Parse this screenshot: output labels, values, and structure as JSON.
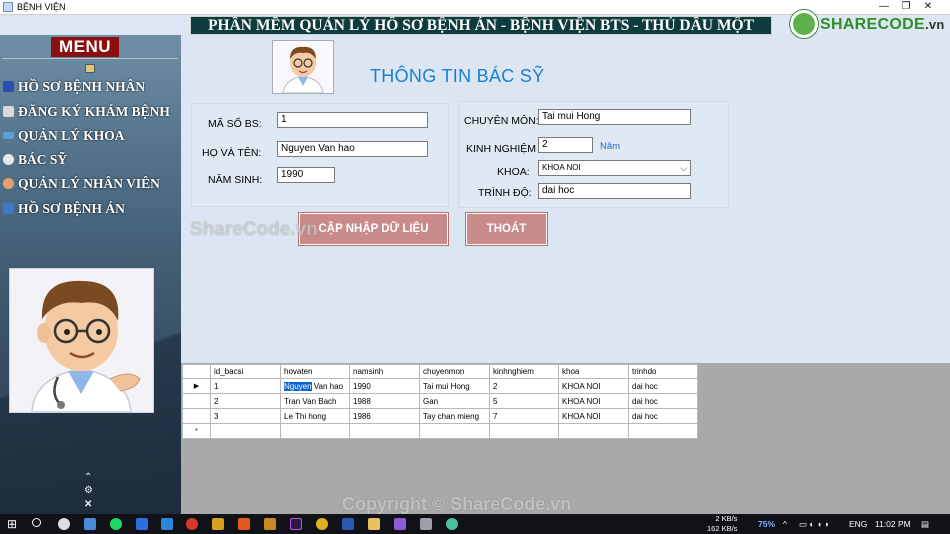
{
  "window": {
    "title": "BỆNH VIỆN",
    "minimize": "—",
    "restore": "❐",
    "close": "✕"
  },
  "banner": "PHẦN MỀM QUẢN LÝ HỒ SƠ BỆNH ÁN - BỆNH VIỆN BTS - THỦ DẦU MỘT",
  "logo": {
    "brand": "SHARECODE",
    "suffix": ".vn",
    "mark_icon": "sharecode-logo-icon",
    "color": "#2e8f2a"
  },
  "sidebar": {
    "title": "MENU",
    "items": [
      {
        "label": "HỒ SƠ BỆNH NHÂN",
        "icon": "patient-record-icon"
      },
      {
        "label": "ĐĂNG KÝ KHÁM BỆNH",
        "icon": "register-icon"
      },
      {
        "label": "QUẢN LÝ KHOA",
        "icon": "department-icon"
      },
      {
        "label": "BÁC SỸ",
        "icon": "doctor-icon"
      },
      {
        "label": "QUẢN LÝ NHÂN VIÊN",
        "icon": "staff-icon"
      },
      {
        "label": "HỒ SƠ BỆNH ÁN",
        "icon": "medical-record-icon"
      }
    ],
    "scroll_up": "⌃",
    "settings": "⚙",
    "close": "✕"
  },
  "form": {
    "title": "THÔNG TIN BÁC SỸ",
    "ma_so_label": "MÃ SỐ BS:",
    "ma_so_value": "1",
    "ho_ten_label": "HỌ VÀ TÊN:",
    "ho_ten_value": "Nguyen Van hao",
    "nam_sinh_label": "NĂM SINH:",
    "nam_sinh_value": "1990",
    "chuyen_mon_label": "CHUYÊN MÔN:",
    "chuyen_mon_value": "Tai mui Hong",
    "kinh_nghiem_label": "KINH NGHIỆM",
    "kinh_nghiem_value": "2",
    "kinh_nghiem_unit": "Năm",
    "khoa_label": "KHOA:",
    "khoa_value": "KHOA NOI",
    "trinh_do_label": "TRÌNH ĐỘ:",
    "trinh_do_value": "dai hoc",
    "update_button": "CẬP NHẬP DỮ LIỆU",
    "exit_button": "THOÁT",
    "button_color": "#c98a8a"
  },
  "grid": {
    "columns": [
      "id_bacsi",
      "hovaten",
      "namsinh",
      "chuyenmon",
      "kinhnghiem",
      "khoa",
      "trinhdo"
    ],
    "rows": [
      {
        "marker": "▶",
        "cells": [
          "1",
          "Nguyen Van hao",
          "1990",
          "Tai mui Hong",
          "2",
          "KHOA NOI",
          "dai hoc"
        ],
        "highlight": "Nguyen"
      },
      {
        "marker": "",
        "cells": [
          "2",
          "Tran Van Bach",
          "1988",
          "Gan",
          "5",
          "KHOA NOI",
          "dai hoc"
        ]
      },
      {
        "marker": "",
        "cells": [
          "3",
          "Le Thi hong",
          "1986",
          "Tay chan mieng",
          "7",
          "KHOA NOI",
          "dai hoc"
        ]
      }
    ],
    "new_row_marker": "*"
  },
  "watermarks": {
    "top": "ShareCode.vn",
    "bottom": "Copyright © ShareCode.vn"
  },
  "taskbar": {
    "net_up": "2 KB/s",
    "net_down": "162 KB/s",
    "battery": "75%",
    "lang": "ENG",
    "time": "11:02 PM"
  }
}
